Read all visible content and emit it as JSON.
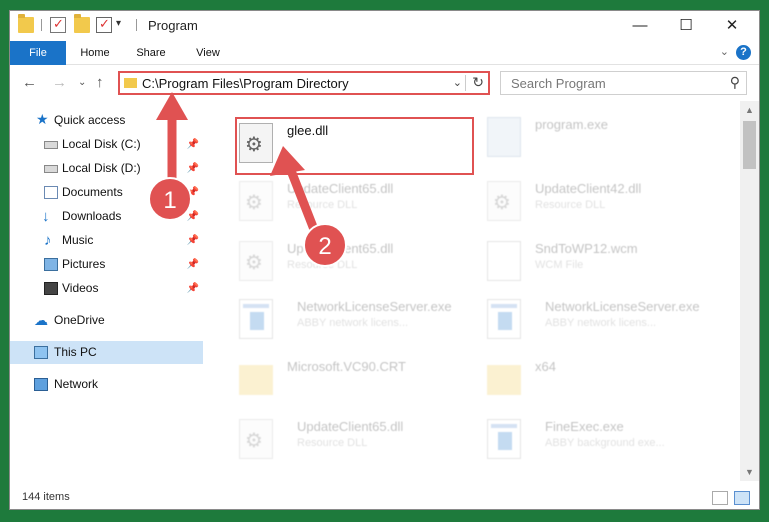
{
  "window": {
    "title": "Program",
    "controls": {
      "minimize": "—",
      "maximize": "☐",
      "close": "✕"
    }
  },
  "ribbon": {
    "tabs": [
      "File",
      "Home",
      "Share",
      "View"
    ],
    "help": "?",
    "expand": "⌄"
  },
  "address": {
    "path": "C:\\Program Files\\Program Directory",
    "dropdown": "⌄",
    "refresh": "↻"
  },
  "search": {
    "placeholder": "Search Program",
    "icon": "⚲"
  },
  "nav": {
    "back": "←",
    "forward": "→",
    "recent": "⌄",
    "up": "↑",
    "items": [
      {
        "label": "Quick access",
        "icon": "star-icon",
        "pinned": false
      },
      {
        "label": "Local Disk (C:)",
        "icon": "disk-icon",
        "pinned": true
      },
      {
        "label": "Local Disk (D:)",
        "icon": "disk-icon",
        "pinned": true
      },
      {
        "label": "Documents",
        "icon": "documents-icon",
        "pinned": true
      },
      {
        "label": "Downloads",
        "icon": "download-icon",
        "pinned": true
      },
      {
        "label": "Music",
        "icon": "music-icon",
        "pinned": true
      },
      {
        "label": "Pictures",
        "icon": "pictures-icon",
        "pinned": true
      },
      {
        "label": "Videos",
        "icon": "videos-icon",
        "pinned": true
      },
      {
        "label": "OneDrive",
        "icon": "cloud-icon",
        "pinned": false
      },
      {
        "label": "This PC",
        "icon": "computer-icon",
        "pinned": false,
        "selected": true
      },
      {
        "label": "Network",
        "icon": "network-icon",
        "pinned": false
      }
    ],
    "pin_glyph": "📌"
  },
  "files": [
    {
      "name": "glee.dll",
      "type": "",
      "icon": "dll",
      "faded": false
    },
    {
      "name": "program.exe",
      "type": "",
      "icon": "prog",
      "faded": true
    },
    {
      "name": "UpdateClient65.dll",
      "type": "Resource DLL",
      "icon": "dll",
      "faded": true
    },
    {
      "name": "UpdateClient42.dll",
      "type": "Resource DLL",
      "icon": "dll",
      "faded": true
    },
    {
      "name": "UpdateClient65.dll",
      "type": "Resource DLL",
      "icon": "dll",
      "faded": true
    },
    {
      "name": "SndToWP12.wcm",
      "type": "WCM File",
      "icon": "doc",
      "faded": true
    },
    {
      "name": "NetworkLicenseServer.exe",
      "type": "ABBY network licens...",
      "icon": "exe",
      "faded": true
    },
    {
      "name": "NetworkLicenseServer.exe",
      "type": "ABBY network licens...",
      "icon": "exe",
      "faded": true
    },
    {
      "name": "Microsoft.VC90.CRT",
      "type": "",
      "icon": "folder",
      "faded": true
    },
    {
      "name": "x64",
      "type": "",
      "icon": "folder",
      "faded": true
    },
    {
      "name": "UpdateClient65.dll",
      "type": "Resource DLL",
      "icon": "dll",
      "faded": true
    },
    {
      "name": "FineExec.exe",
      "type": "ABBY background exe...",
      "icon": "exe",
      "faded": true
    }
  ],
  "status": {
    "count": "144 items"
  },
  "annotations": {
    "step1": "1",
    "step2": "2",
    "accent": "#e05252"
  }
}
